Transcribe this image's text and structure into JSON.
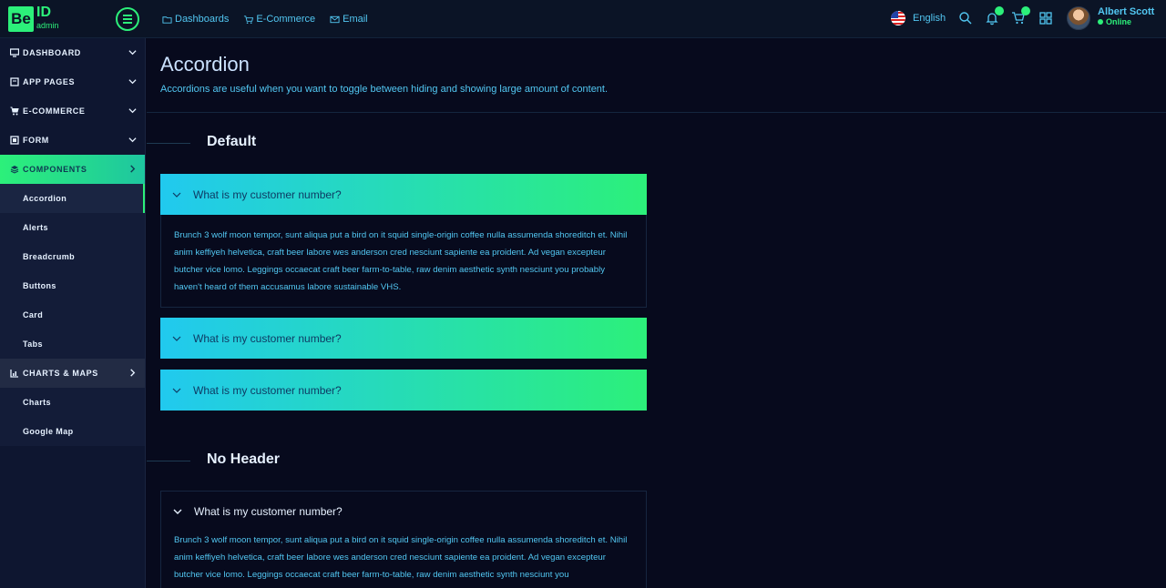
{
  "brand": {
    "mark": "Be",
    "id": "ID",
    "sub": "admin"
  },
  "topnav": [
    {
      "label": "Dashboards",
      "icon": "folder-icon"
    },
    {
      "label": "E-Commerce",
      "icon": "cart-icon"
    },
    {
      "label": "Email",
      "icon": "mail-icon"
    }
  ],
  "language": {
    "label": "English",
    "flag": "us-flag-icon"
  },
  "user": {
    "name": "Albert Scott",
    "status": "Online"
  },
  "sidebar": {
    "sections": [
      {
        "label": "DASHBOARD",
        "icon": "monitor-icon"
      },
      {
        "label": "APP PAGES",
        "icon": "page-icon"
      },
      {
        "label": "E-COMMERCE",
        "icon": "cart-icon"
      },
      {
        "label": "FORM",
        "icon": "form-icon"
      },
      {
        "label": "COMPONENTS",
        "icon": "layers-icon"
      },
      {
        "label": "CHARTS & MAPS",
        "icon": "chart-icon"
      }
    ],
    "components_items": [
      "Accordion",
      "Alerts",
      "Breadcrumb",
      "Buttons",
      "Card",
      "Tabs"
    ],
    "charts_items": [
      "Charts",
      "Google Map"
    ]
  },
  "page": {
    "title": "Accordion",
    "description": "Accordions are useful when you want to toggle between hiding and showing large amount of content."
  },
  "default_section": {
    "title": "Default",
    "items": [
      {
        "question": "What is my customer number?"
      },
      {
        "question": "What is my customer number?"
      },
      {
        "question": "What is my customer number?"
      }
    ],
    "body": "Brunch 3 wolf moon tempor, sunt aliqua put a bird on it squid single-origin coffee nulla assumenda shoreditch et. Nihil anim keffiyeh helvetica, craft beer labore wes anderson cred nesciunt sapiente ea proident. Ad vegan excepteur butcher vice lomo. Leggings occaecat craft beer farm-to-table, raw denim aesthetic synth nesciunt you probably haven't heard of them accusamus labore sustainable VHS."
  },
  "noheader_section": {
    "title": "No Header",
    "question": "What is my customer number?",
    "body": "Brunch 3 wolf moon tempor, sunt aliqua put a bird on it squid single-origin coffee nulla assumenda shoreditch et. Nihil anim keffiyeh helvetica, craft beer labore wes anderson cred nesciunt sapiente ea proident. Ad vegan excepteur butcher vice lomo. Leggings occaecat craft beer farm-to-table, raw denim aesthetic synth nesciunt you"
  },
  "colors": {
    "accent": "#2cf07a",
    "cyan": "#21c9ef",
    "link": "#52c7f2",
    "background": "#070a1d"
  }
}
